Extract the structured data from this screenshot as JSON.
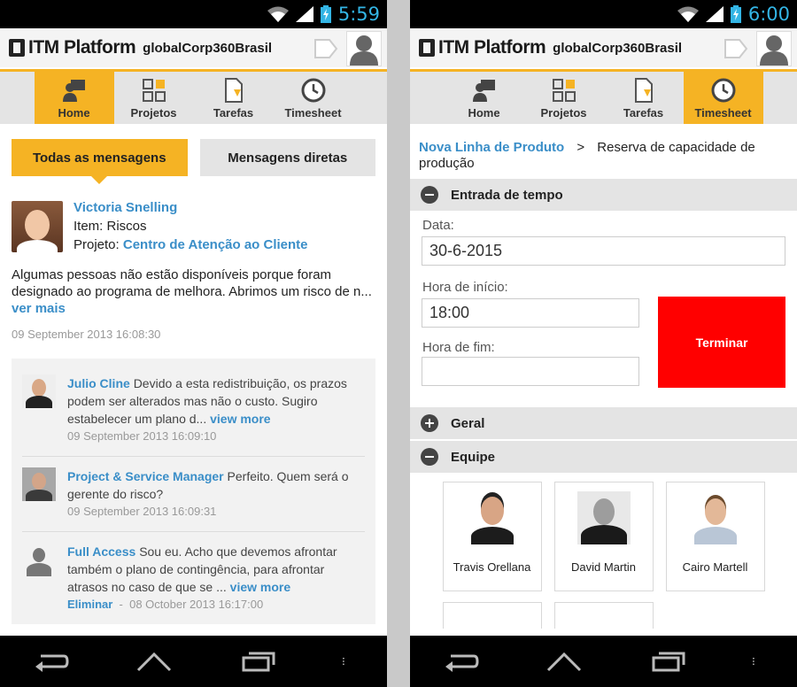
{
  "left": {
    "status": {
      "time": "5:59"
    },
    "app": {
      "brand": "ITM Platform",
      "company": "globalCorp360Brasil"
    },
    "nav": [
      {
        "label": "Home",
        "icon": "home-icon",
        "active": true
      },
      {
        "label": "Projetos",
        "icon": "projects-icon",
        "active": false
      },
      {
        "label": "Tarefas",
        "icon": "tasks-icon",
        "active": false
      },
      {
        "label": "Timesheet",
        "icon": "clock-icon",
        "active": false
      }
    ],
    "tabs": {
      "all": "Todas as mensagens",
      "direct": "Mensagens diretas"
    },
    "post": {
      "author": "Victoria Snelling",
      "item_label": "Item:",
      "item_value": "Riscos",
      "project_label": "Projeto:",
      "project_value": "Centro de Atenção ao Cliente",
      "text": "Algumas pessoas não estão disponíveis porque foram designado ao programa de melhora. Abrimos um risco de n...",
      "more": "ver mais",
      "time": "09 September 2013 16:08:30"
    },
    "comments": [
      {
        "author": "Julio Cline",
        "text": "Devido a esta redistribuição, os prazos podem ser alterados mas não o custo. Sugiro estabelecer um plano d...",
        "more": "view more",
        "time": "09 September 2013 16:09:10"
      },
      {
        "author": "Project & Service Manager",
        "text": "Perfeito. Quem será o gerente do risco?",
        "more": "",
        "time": "09 September 2013 16:09:31"
      },
      {
        "author": "Full Access",
        "text": "Sou eu. Acho que devemos afrontar também o plano de contingência, para afrontar atrasos no caso de que se ...",
        "more": "view more",
        "delete": "Eliminar",
        "dash": "-",
        "time": "08 October 2013 16:17:00"
      }
    ]
  },
  "right": {
    "status": {
      "time": "6:00"
    },
    "app": {
      "brand": "ITM Platform",
      "company": "globalCorp360Brasil"
    },
    "nav": [
      {
        "label": "Home",
        "icon": "home-icon",
        "active": false
      },
      {
        "label": "Projetos",
        "icon": "projects-icon",
        "active": false
      },
      {
        "label": "Tarefas",
        "icon": "tasks-icon",
        "active": false
      },
      {
        "label": "Timesheet",
        "icon": "clock-icon",
        "active": true
      }
    ],
    "breadcrumb": {
      "parent": "Nova Linha de Produto",
      "separator": ">",
      "current": "Reserva de capacidade de produção"
    },
    "sections": {
      "time_entry": "Entrada de tempo",
      "general": "Geral",
      "team": "Equipe"
    },
    "form": {
      "date_label": "Data:",
      "date_value": "30-6-2015",
      "start_label": "Hora de início:",
      "start_value": "18:00",
      "end_label": "Hora de fim:",
      "end_value": "",
      "finish_button": "Terminar"
    },
    "team": [
      {
        "name": "Travis Orellana"
      },
      {
        "name": "David Martin"
      },
      {
        "name": "Cairo Martell"
      }
    ]
  },
  "colors": {
    "accent": "#f5b324",
    "link": "#3a8ec8",
    "finish": "#ff0000",
    "status_blue": "#33b5e5"
  }
}
